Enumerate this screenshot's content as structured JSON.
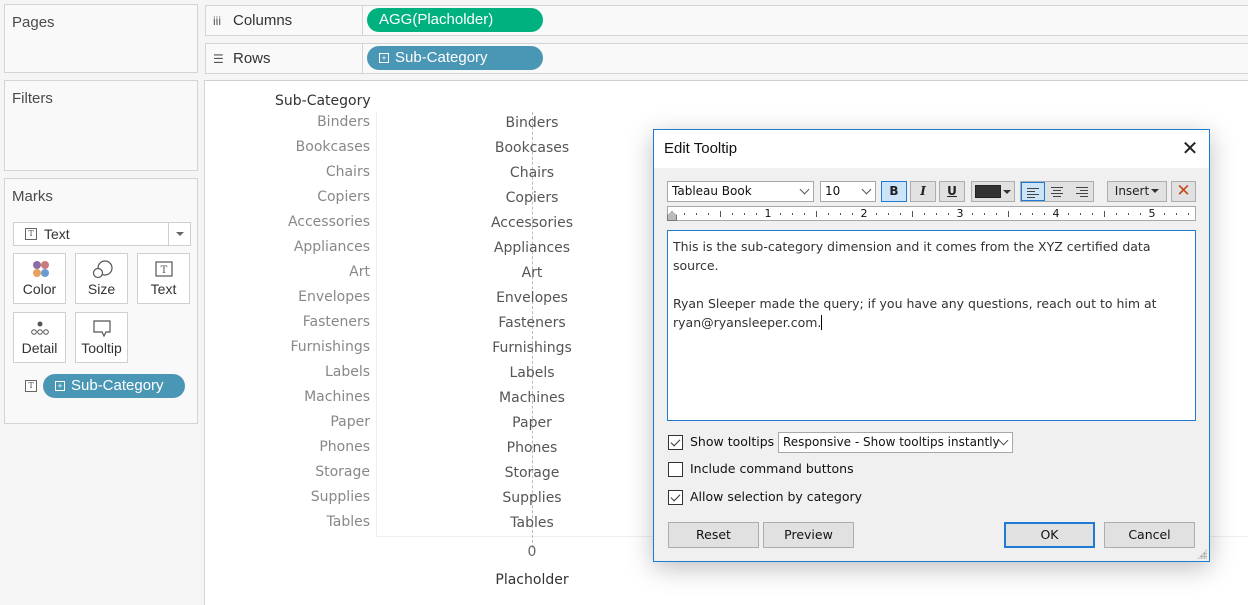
{
  "left_panels": {
    "pages_title": "Pages",
    "filters_title": "Filters",
    "marks_title": "Marks",
    "mark_type": "Text",
    "mark_buttons": [
      {
        "label": "Color",
        "icon": "color-dots-icon"
      },
      {
        "label": "Size",
        "icon": "size-circles-icon"
      },
      {
        "label": "Text",
        "icon": "text-box-icon"
      },
      {
        "label": "Detail",
        "icon": "detail-dots-icon"
      },
      {
        "label": "Tooltip",
        "icon": "speech-bubble-icon"
      }
    ],
    "marks_pill": {
      "label": "Sub-Category",
      "prefix_icon": "plus-box-icon",
      "encoding_icon": "text-box-icon",
      "color": "#4a96b5"
    }
  },
  "shelves": {
    "columns": {
      "label": "Columns",
      "icon": "columns-icon",
      "pill": {
        "label": "AGG(Placholder)",
        "color": "#00b180"
      }
    },
    "rows": {
      "label": "Rows",
      "icon": "rows-icon",
      "pill": {
        "label": "Sub-Category",
        "prefix_icon": "plus-box-icon",
        "color": "#4a96b5"
      }
    }
  },
  "viz": {
    "row_header_title": "Sub-Category",
    "categories": [
      "Binders",
      "Bookcases",
      "Chairs",
      "Copiers",
      "Accessories",
      "Appliances",
      "Art",
      "Envelopes",
      "Fasteners",
      "Furnishings",
      "Labels",
      "Machines",
      "Paper",
      "Phones",
      "Storage",
      "Supplies",
      "Tables"
    ],
    "axis_tick": "0",
    "axis_title": "Placholder"
  },
  "dialog": {
    "title": "Edit Tooltip",
    "close_icon": "close-x-icon",
    "font": "Tableau Book",
    "font_size": "10",
    "bold_label": "B",
    "italic_label": "I",
    "underline_label": "U",
    "text_color": "#333333",
    "insert_label": "Insert",
    "clear_icon": "red-x-icon",
    "ruler_numbers": [
      "1",
      "2",
      "3",
      "4",
      "5"
    ],
    "body_para1": "This is the sub-category dimension and it comes from the XYZ certified data source.",
    "body_para2": "Ryan Sleeper made the query; if you have any questions, reach out to him at ryan@ryansleeper.com.",
    "show_tooltips": {
      "label": "Show tooltips",
      "checked": true
    },
    "tooltip_mode": "Responsive - Show tooltips instantly",
    "include_command_buttons": {
      "label": "Include command buttons",
      "checked": false
    },
    "allow_selection": {
      "label": "Allow selection by category",
      "checked": true
    },
    "reset_label": "Reset",
    "preview_label": "Preview",
    "ok_label": "OK",
    "cancel_label": "Cancel",
    "accent_color": "#1e7ad2"
  }
}
